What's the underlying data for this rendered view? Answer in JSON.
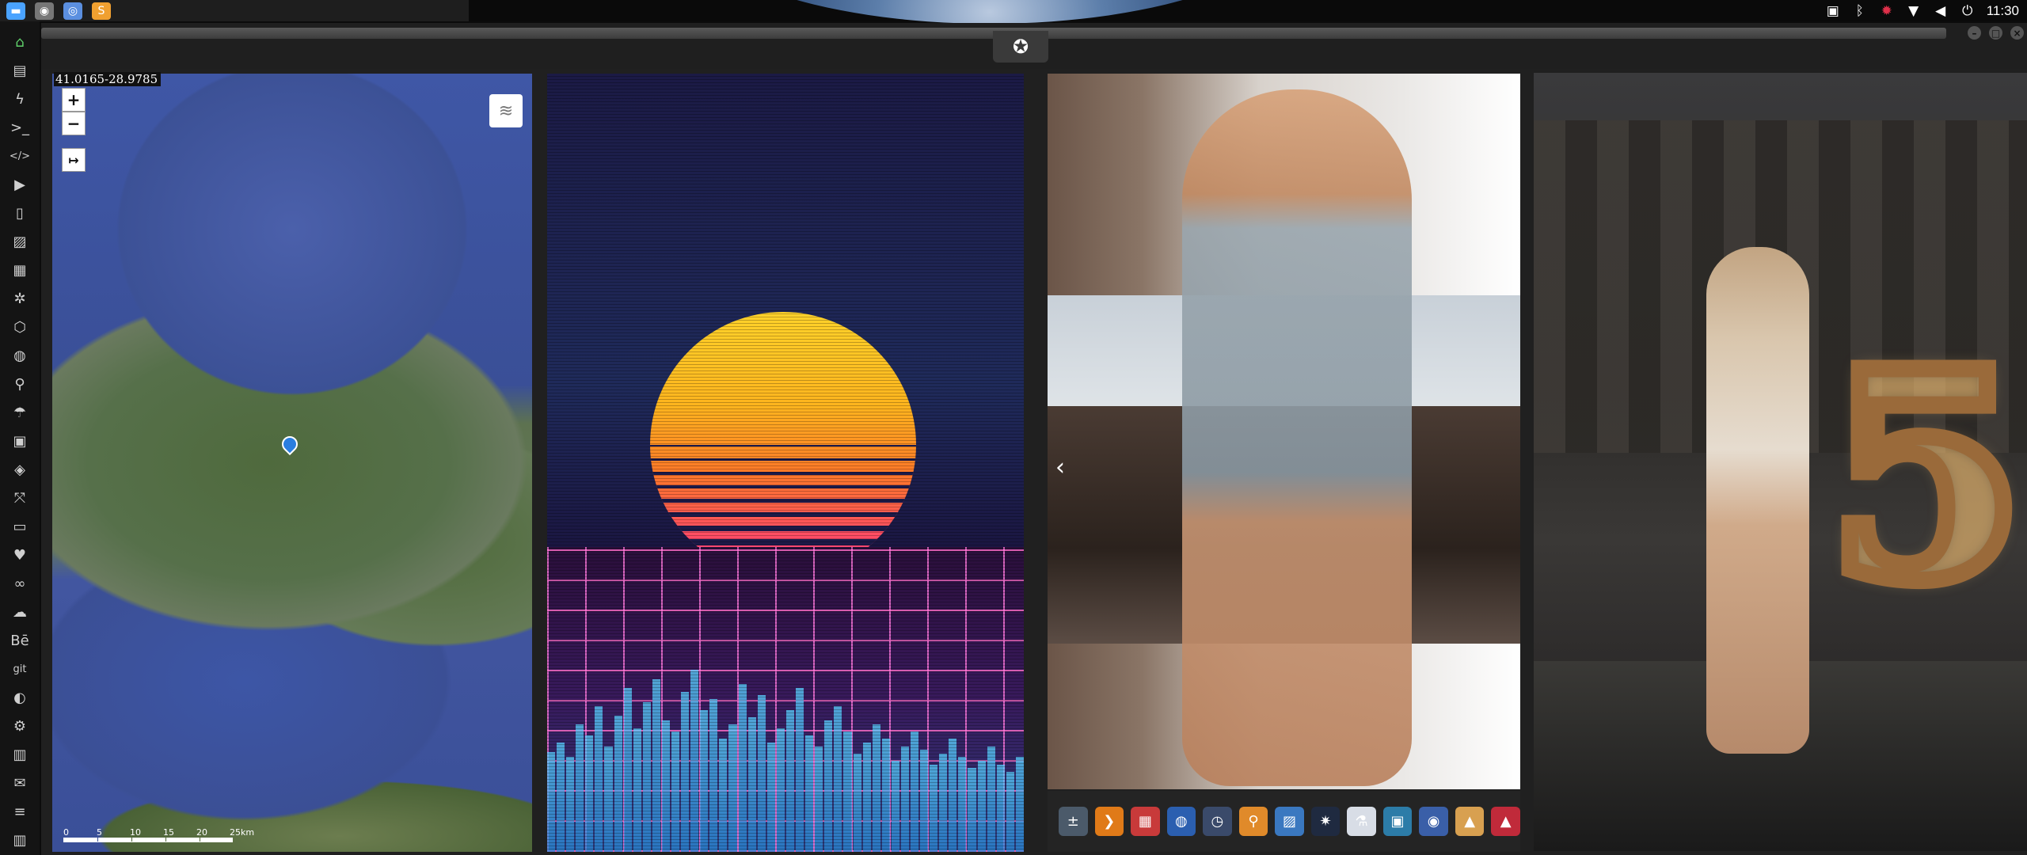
{
  "taskbar": {
    "apps": [
      {
        "name": "files-icon",
        "glyph": "▬",
        "color": "#4aa3ff"
      },
      {
        "name": "window-icon",
        "glyph": "◉",
        "color": "#777"
      },
      {
        "name": "chrome-icon",
        "glyph": "◎",
        "color": "#5b8fe0"
      },
      {
        "name": "sublime-icon",
        "glyph": "S",
        "color": "#f0a030"
      }
    ]
  },
  "tray": {
    "clock": "11:30",
    "icons": [
      "image-icon",
      "bluetooth-icon",
      "settings-icon",
      "wifi-icon",
      "volume-icon",
      "power-icon"
    ]
  },
  "dock": {
    "items": [
      {
        "name": "home-icon",
        "glyph": "⌂",
        "active": true
      },
      {
        "name": "document-icon",
        "glyph": "▤"
      },
      {
        "name": "bolt-icon",
        "glyph": "ϟ"
      },
      {
        "name": "terminal-icon",
        "glyph": ">_"
      },
      {
        "name": "code-icon",
        "glyph": "</>"
      },
      {
        "name": "play-icon",
        "glyph": "▶"
      },
      {
        "name": "devices-icon",
        "glyph": "▯"
      },
      {
        "name": "image-icon",
        "glyph": "▨"
      },
      {
        "name": "news-icon",
        "glyph": "▦"
      },
      {
        "name": "settings-icon",
        "glyph": "✲"
      },
      {
        "name": "hexagon-icon",
        "glyph": "⬡"
      },
      {
        "name": "globe-icon",
        "glyph": "◍"
      },
      {
        "name": "search-icon",
        "glyph": "⚲"
      },
      {
        "name": "umbrella-icon",
        "glyph": "☂"
      },
      {
        "name": "contact-icon",
        "glyph": "▣"
      },
      {
        "name": "tag-icon",
        "glyph": "◈"
      },
      {
        "name": "expand-icon",
        "glyph": "⤧"
      },
      {
        "name": "youtube-icon",
        "glyph": "▭"
      },
      {
        "name": "heart-icon",
        "glyph": "♥"
      },
      {
        "name": "infinity-icon",
        "glyph": "∞"
      },
      {
        "name": "cloud-icon",
        "glyph": "☁"
      },
      {
        "name": "behance-icon",
        "glyph": "Bē"
      },
      {
        "name": "git-icon",
        "glyph": "git"
      },
      {
        "name": "github-icon",
        "glyph": "◐"
      },
      {
        "name": "bike-icon",
        "glyph": "⚙"
      },
      {
        "name": "map-icon",
        "glyph": "▥"
      },
      {
        "name": "mail-icon",
        "glyph": "✉"
      },
      {
        "name": "server-icon",
        "glyph": "≡"
      },
      {
        "name": "trash-icon",
        "glyph": "▥"
      }
    ]
  },
  "window": {
    "badge_glyph": "✪"
  },
  "map": {
    "coords": "41.0165-28.9785",
    "zoom_in": "+",
    "zoom_out": "−",
    "expand": "↦",
    "layers_glyph": "≋",
    "scale_labels": [
      "0",
      "5",
      "10",
      "15",
      "20",
      "25km"
    ]
  },
  "photos": {
    "prev_glyph": "‹",
    "five": "5"
  },
  "launcher": {
    "apps": [
      {
        "name": "calculator-icon",
        "glyph": "±",
        "color": "#4b5a6a"
      },
      {
        "name": "arrow-app-icon",
        "glyph": "❯",
        "color": "#e07a18"
      },
      {
        "name": "calendar-icon",
        "glyph": "▦",
        "color": "#c83a3a"
      },
      {
        "name": "browser-icon",
        "glyph": "◍",
        "color": "#2b5fb0"
      },
      {
        "name": "clock-app-icon",
        "glyph": "◷",
        "color": "#3a4a6a"
      },
      {
        "name": "search-app-icon",
        "glyph": "⚲",
        "color": "#e08a2a"
      },
      {
        "name": "photos-app-icon",
        "glyph": "▨",
        "color": "#3a78c0"
      },
      {
        "name": "network-app-icon",
        "glyph": "✷",
        "color": "#1f2a40"
      },
      {
        "name": "science-app-icon",
        "glyph": "⚗",
        "color": "#d8dde6"
      },
      {
        "name": "terminal-app-icon",
        "glyph": "▣",
        "color": "#2c7ca8"
      },
      {
        "name": "planet-app-icon",
        "glyph": "◉",
        "color": "#3a5fa8"
      },
      {
        "name": "pyramid-app-icon",
        "glyph": "▲",
        "color": "#d8a050"
      },
      {
        "name": "vector-app-icon",
        "glyph": "▲",
        "color": "#c02a3a"
      }
    ]
  }
}
